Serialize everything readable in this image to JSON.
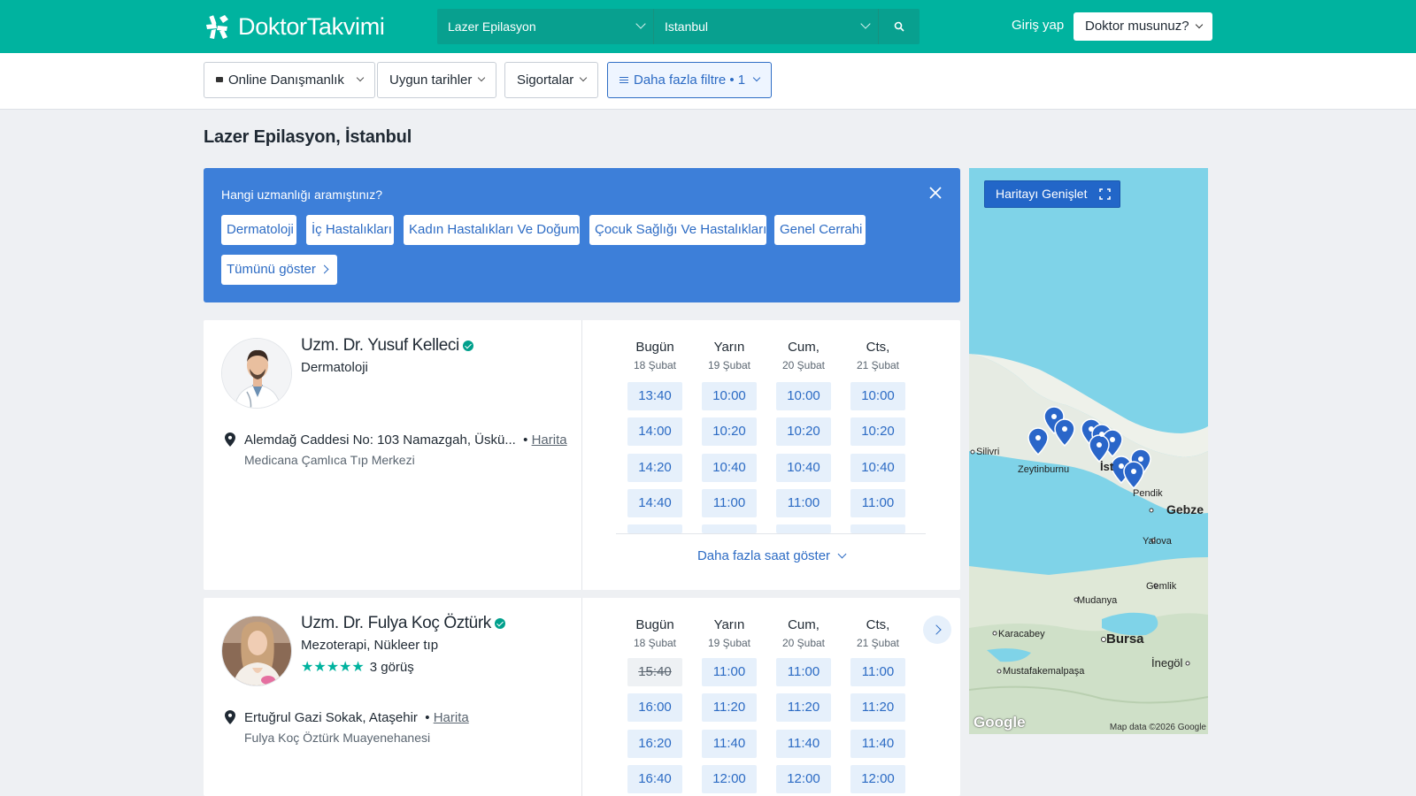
{
  "header": {
    "brand": "DoktorTakvimi",
    "search": {
      "specialty": "Lazer Epilasyon",
      "city": "Istanbul"
    },
    "login_label": "Giriş yap",
    "doctor_menu_label": "Doktor musunuz?"
  },
  "filters": [
    {
      "label": "Online Danışmanlık",
      "active": false
    },
    {
      "label": "Uygun tarihler",
      "active": false
    },
    {
      "label": "Sigortalar",
      "active": false
    },
    {
      "label": "Daha fazla filtre • 1",
      "active": true
    }
  ],
  "page_title": "Lazer Epilasyon, İstanbul",
  "specialty_panel": {
    "question": "Hangi uzmanlığı aramıştınız?",
    "chips": [
      "Dermatoloji",
      "İç Hastalıkları",
      "Kadın Hastalıkları Ve Doğum",
      "Çocuk Sağlığı Ve Hastalıkları",
      "Genel Cerrahi"
    ],
    "show_all": "Tümünü göster",
    "colors": {
      "panel": "#3d7fd9"
    }
  },
  "doctors": [
    {
      "name": "Uzm. Dr. Yusuf Kelleci",
      "specialty": "Dermatoloji",
      "address": "Alemdağ Caddesi No: 103 Namazgah, Üskü...",
      "map_link": "Harita",
      "clinic": "Medicana Çamlıca Tıp Merkezi",
      "days": [
        {
          "name": "Bugün",
          "date": "18 Şubat",
          "slots": [
            "13:40",
            "14:00",
            "14:20",
            "14:40"
          ]
        },
        {
          "name": "Yarın",
          "date": "19 Şubat",
          "slots": [
            "10:00",
            "10:20",
            "10:40",
            "11:00"
          ]
        },
        {
          "name": "Cum,",
          "date": "20 Şubat",
          "slots": [
            "10:00",
            "10:20",
            "10:40",
            "11:00"
          ]
        },
        {
          "name": "Cts,",
          "date": "21 Şubat",
          "slots": [
            "10:00",
            "10:20",
            "10:40",
            "11:00"
          ]
        }
      ],
      "more_hours": "Daha fazla saat göster"
    },
    {
      "name": "Uzm. Dr. Fulya Koç Öztürk",
      "specialty": "Mezoterapi, Nükleer tıp",
      "reviews": "3 görüş",
      "rating_stars": 5,
      "address": "Ertuğrul Gazi Sokak, Ataşehir",
      "map_link": "Harita",
      "clinic": "Fulya Koç Öztürk Muayenehanesi",
      "days": [
        {
          "name": "Bugün",
          "date": "18 Şubat",
          "slots": [
            "15:40",
            "16:00",
            "16:20",
            "16:40"
          ],
          "past_first": true
        },
        {
          "name": "Yarın",
          "date": "19 Şubat",
          "slots": [
            "11:00",
            "11:20",
            "11:40",
            "12:00"
          ]
        },
        {
          "name": "Cum,",
          "date": "20 Şubat",
          "slots": [
            "11:00",
            "11:20",
            "11:40",
            "12:00"
          ]
        },
        {
          "name": "Cts,",
          "date": "21 Şubat",
          "slots": [
            "11:00",
            "11:20",
            "11:40",
            "12:00"
          ]
        }
      ]
    }
  ],
  "map": {
    "expand_label": "Haritayı Genişlet",
    "labels": [
      "Silivri",
      "Zeytinburnu",
      "Pendik",
      "Gebze",
      "Yalova",
      "Gemlik",
      "Mudanya",
      "Karacabey",
      "Bursa",
      "İnegöl",
      "Mustafakemalpaşa",
      "İst"
    ],
    "attribution": "Map data ©2026 Google",
    "google": "Google"
  },
  "colors": {
    "brand": "#00b39f",
    "accent_blue": "#2c6bc4",
    "slot_bg": "#e6f0fb"
  }
}
